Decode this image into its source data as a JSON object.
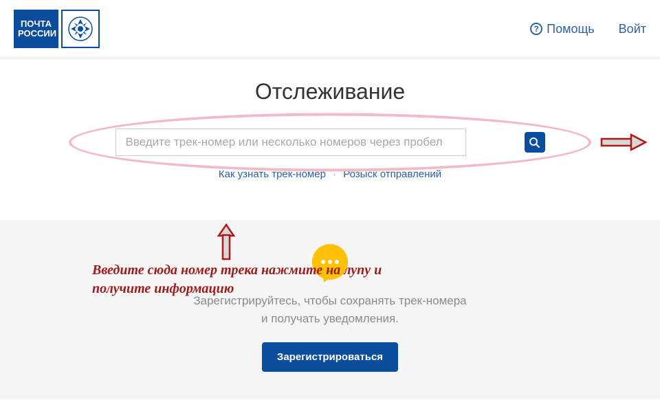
{
  "header": {
    "logo_line1": "ПОЧТА",
    "logo_line2": "РОССИИ",
    "help_label": "Помощь",
    "login_label": "Войт"
  },
  "main": {
    "title": "Отслеживание",
    "search_placeholder": "Введите трек-номер или несколько номеров через пробел",
    "link_how": "Как узнать трек-номер",
    "link_search": "Розыск отправлений"
  },
  "annotation": {
    "line1": "Введите сюда номер трека нажмите на лупу и",
    "line2": "получите информацию"
  },
  "bottom": {
    "promo_line1": "Зарегистрируйтесь, чтобы сохранять трек-номера",
    "promo_line2": "и получать уведомления.",
    "register_label": "Зарегистрироваться"
  }
}
